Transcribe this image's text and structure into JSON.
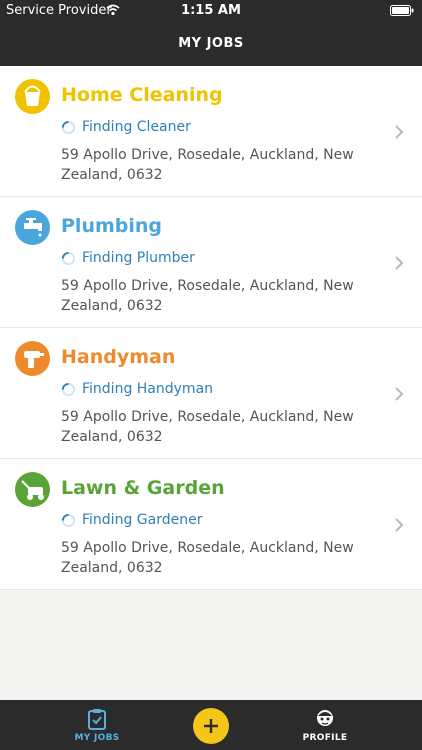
{
  "status_bar": {
    "carrier": "Service Provider",
    "time": "1:15 AM"
  },
  "nav": {
    "title": "MY JOBS"
  },
  "jobs": [
    {
      "title": "Home Cleaning",
      "status": "Finding Cleaner",
      "address": "59 Apollo Drive, Rosedale, Auckland, New Zealand, 0632",
      "color": "#f2c100",
      "icon": "bucket-icon"
    },
    {
      "title": "Plumbing",
      "status": "Finding Plumber",
      "address": "59 Apollo Drive, Rosedale, Auckland, New Zealand, 0632",
      "color": "#4aa6dc",
      "icon": "faucet-icon"
    },
    {
      "title": "Handyman",
      "status": "Finding Handyman",
      "address": "59 Apollo Drive, Rosedale, Auckland, New Zealand, 0632",
      "color": "#ee8a2c",
      "icon": "drill-icon"
    },
    {
      "title": "Lawn & Garden",
      "status": "Finding Gardener",
      "address": "59 Apollo Drive, Rosedale, Auckland, New Zealand, 0632",
      "color": "#5aa437",
      "icon": "lawnmower-icon"
    }
  ],
  "tab_bar": {
    "my_jobs_label": "MY JOBS",
    "profile_label": "PROFILE",
    "add_icon": "plus-icon",
    "accent": "#5aaee0",
    "add_color": "#f5c518"
  },
  "colors": {
    "header_bg": "#2b2b2b",
    "status_text": "#2f7fb9",
    "address_text": "#555555",
    "background": "#f4f4f2"
  }
}
